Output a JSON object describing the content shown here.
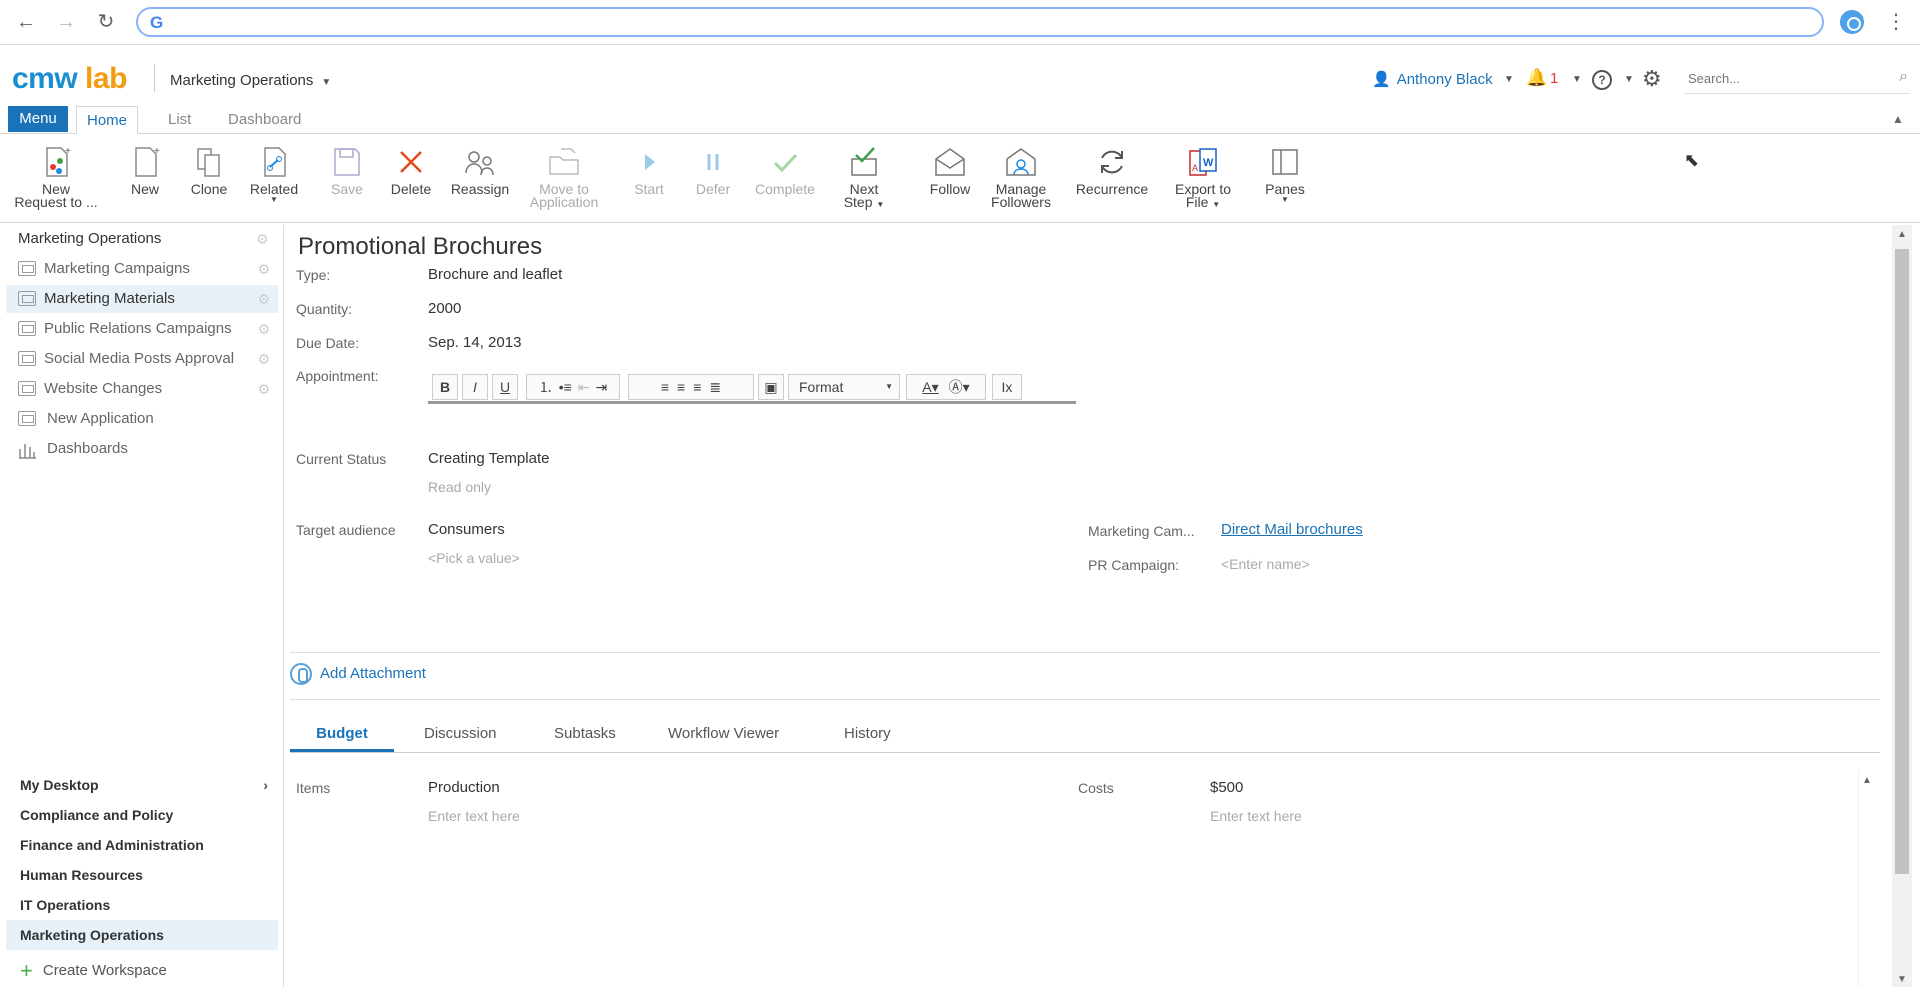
{
  "browser": {
    "url": ""
  },
  "header": {
    "logo_cmw": "cmw",
    "logo_lab": "lab",
    "workspace": "Marketing Operations",
    "user_name": "Anthony Black",
    "notification_count": "1",
    "search_placeholder": "Search..."
  },
  "tabs": {
    "menu": "Menu",
    "home": "Home",
    "list": "List",
    "dashboard": "Dashboard"
  },
  "ribbon": [
    {
      "id": "new-request",
      "label1": "New",
      "label2": "Request to ..."
    },
    {
      "id": "new",
      "label1": "New",
      "label2": ""
    },
    {
      "id": "clone",
      "label1": "Clone",
      "label2": ""
    },
    {
      "id": "related",
      "label1": "Related",
      "label2": ""
    },
    {
      "id": "save",
      "label1": "Save",
      "label2": ""
    },
    {
      "id": "delete",
      "label1": "Delete",
      "label2": ""
    },
    {
      "id": "reassign",
      "label1": "Reassign",
      "label2": ""
    },
    {
      "id": "move-to-application",
      "label1": "Move to",
      "label2": "Application"
    },
    {
      "id": "start",
      "label1": "Start",
      "label2": ""
    },
    {
      "id": "defer",
      "label1": "Defer",
      "label2": ""
    },
    {
      "id": "complete",
      "label1": "Complete",
      "label2": ""
    },
    {
      "id": "next-step",
      "label1": "Next",
      "label2": "Step"
    },
    {
      "id": "follow",
      "label1": "Follow",
      "label2": ""
    },
    {
      "id": "manage-followers",
      "label1": "Manage",
      "label2": "Followers"
    },
    {
      "id": "recurrence",
      "label1": "Recurrence",
      "label2": ""
    },
    {
      "id": "export-to-file",
      "label1": "Export to",
      "label2": "File"
    },
    {
      "id": "panes",
      "label1": "Panes",
      "label2": ""
    }
  ],
  "sidebar": {
    "header": "Marketing Operations",
    "items": [
      "Marketing Campaigns",
      "Marketing Materials",
      "Public Relations Campaigns",
      "Social Media Posts Approval",
      "Website Changes",
      "New Application",
      "Dashboards"
    ],
    "workspaces": [
      "My Desktop",
      "Compliance and Policy",
      "Finance and Administration",
      "Human Resources",
      "IT Operations",
      "Marketing Operations"
    ],
    "create_workspace": "Create Workspace"
  },
  "form": {
    "title": "Promotional Brochures",
    "type_label": "Type:",
    "type_value": "Brochure and leaflet",
    "quantity_label": "Quantity:",
    "quantity_value": "2000",
    "due_label": "Due Date:",
    "due_value": "Sep. 14, 2013",
    "appointment_label": "Appointment:",
    "editor_format": "Format",
    "status_label": "Current Status",
    "status_value": "Creating Template",
    "status_hint": "Read only",
    "audience_label": "Target audience",
    "audience_value": "Consumers",
    "audience_hint": "<Pick a value>",
    "campaign_label": "Marketing Cam...",
    "campaign_value": "Direct Mail brochures",
    "pr_label": "PR Campaign:",
    "pr_hint": "<Enter name>",
    "add_attachment": "Add Attachment"
  },
  "subtabs": [
    "Budget",
    "Discussion",
    "Subtasks",
    "Workflow Viewer",
    "History"
  ],
  "budget": {
    "items_label": "Items",
    "items_value": "Production",
    "items_hint": "Enter text here",
    "costs_label": "Costs",
    "costs_value": "$500",
    "costs_hint": "Enter text here"
  }
}
